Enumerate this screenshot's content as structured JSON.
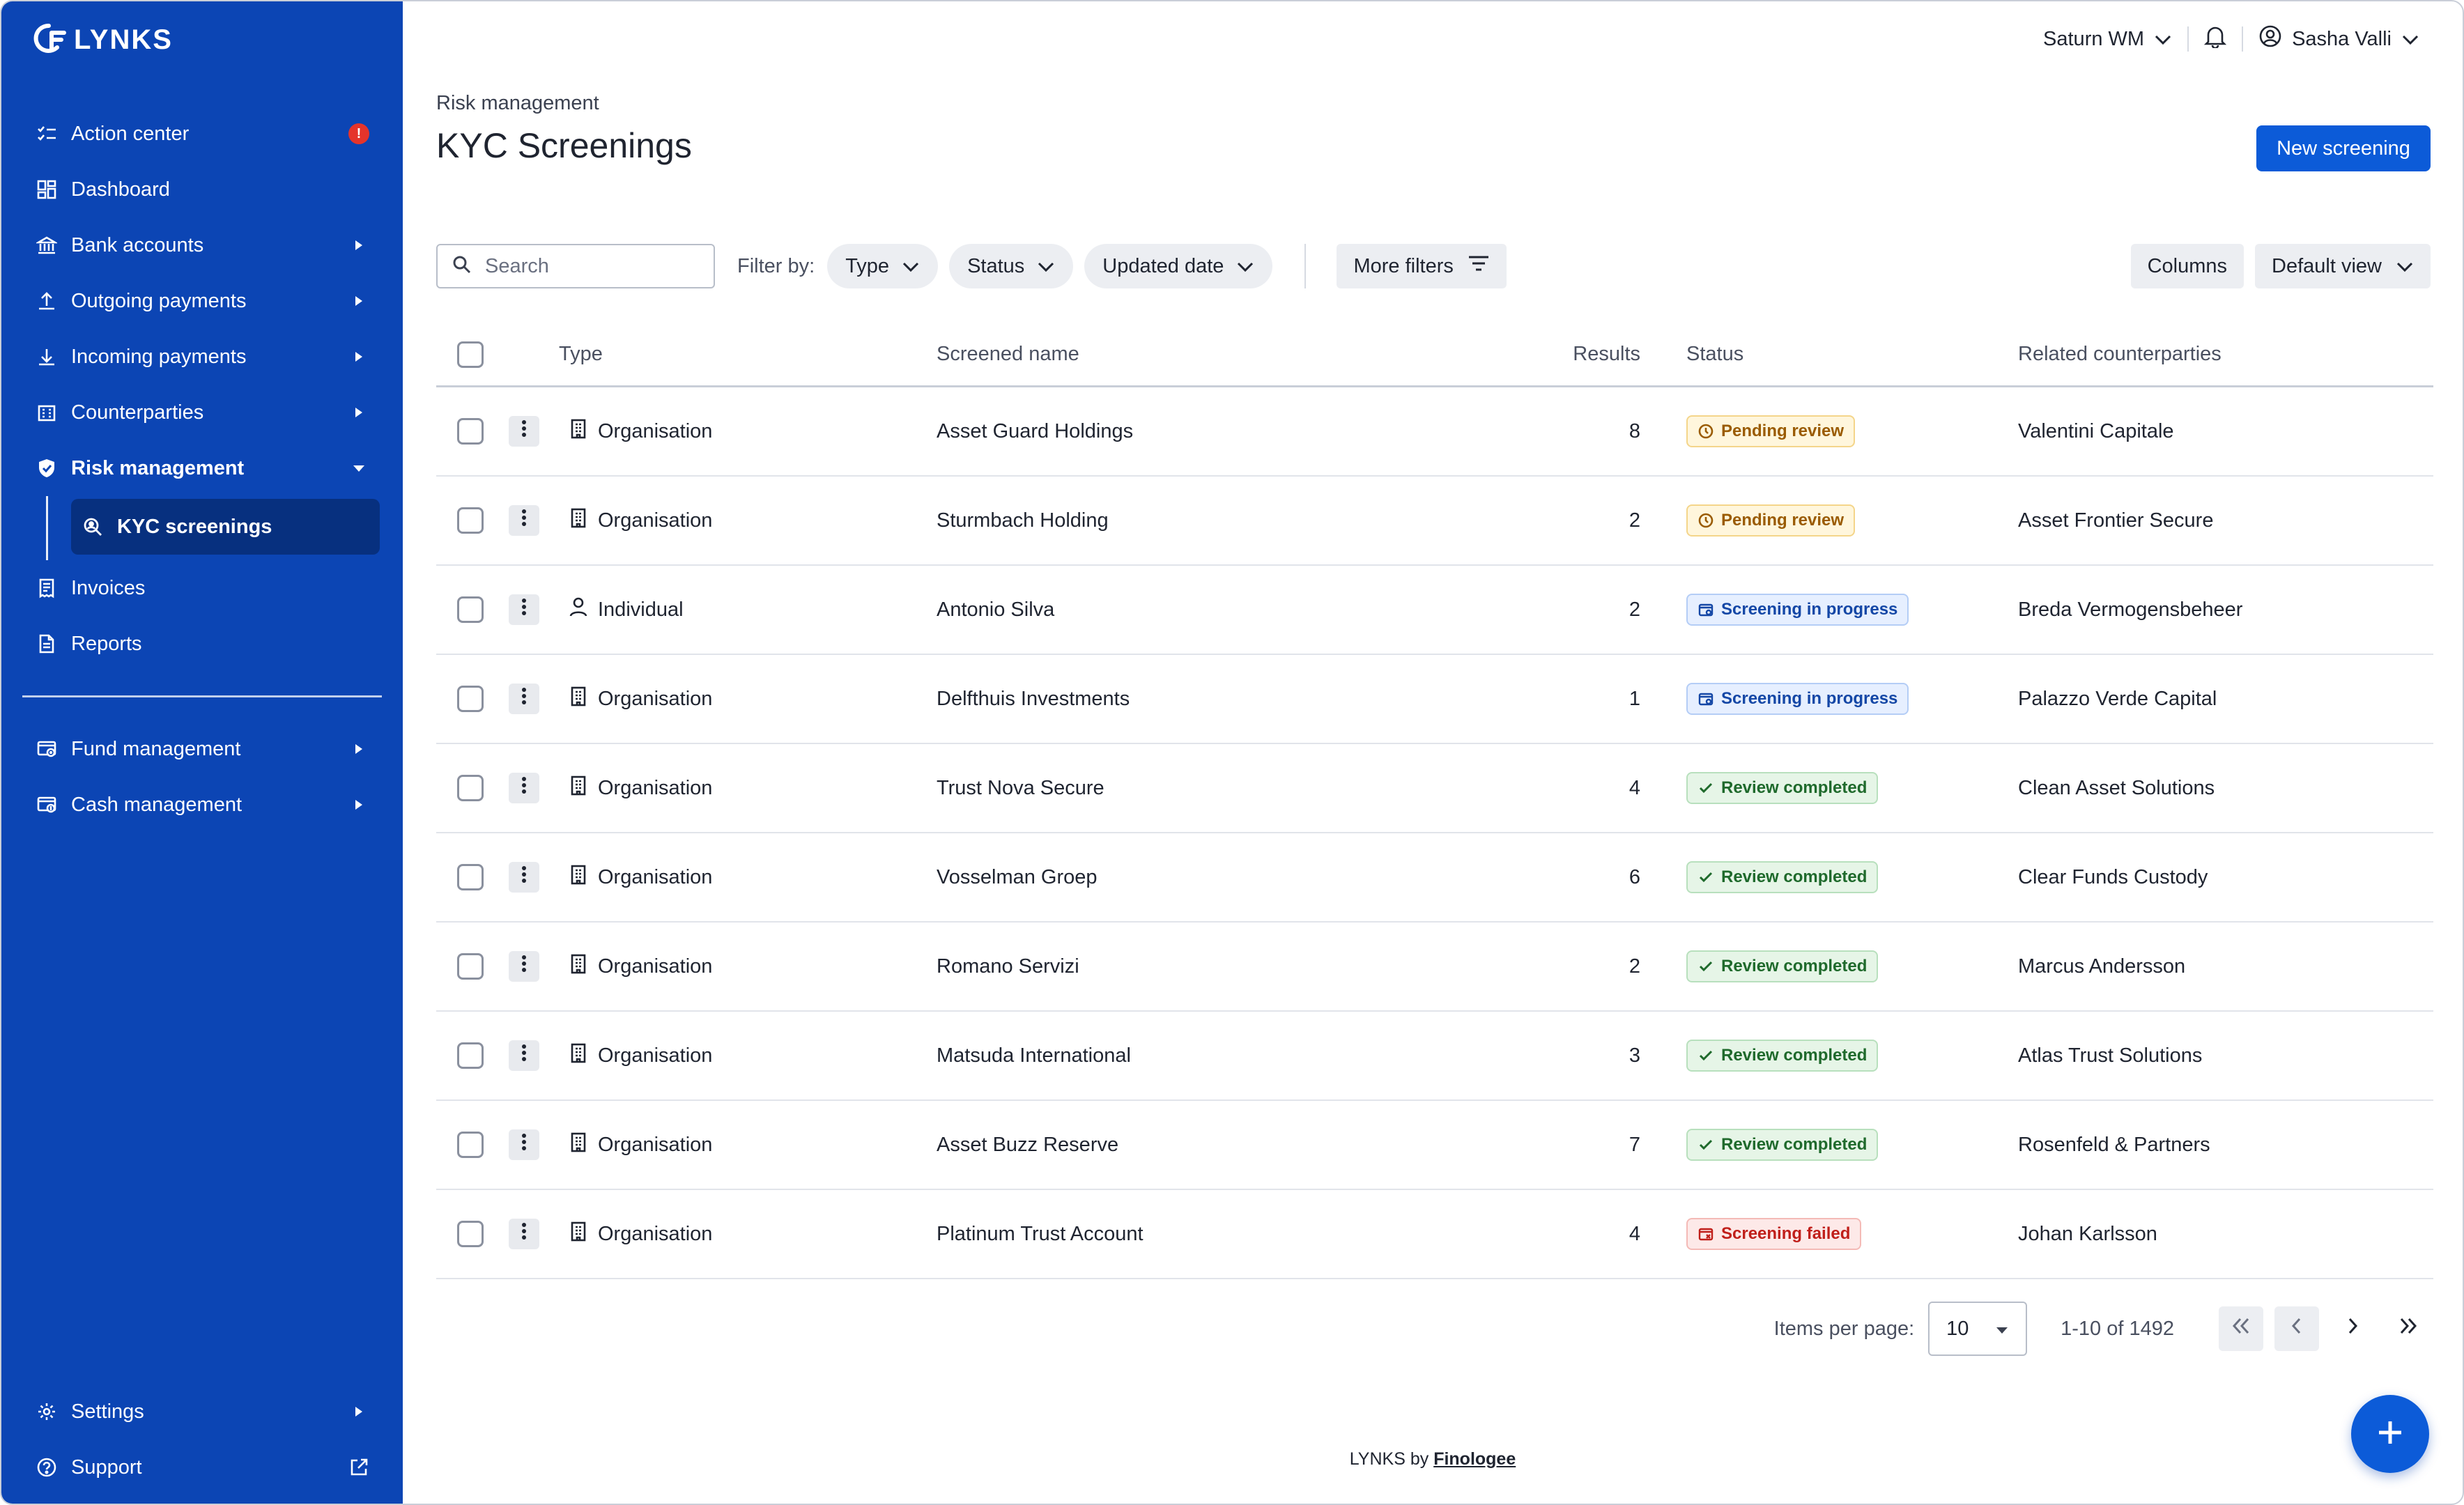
{
  "app": {
    "logo_text": "LYNKS"
  },
  "sidebar": {
    "items": [
      {
        "label": "Action center",
        "icon": "checklist-icon",
        "alert": "!"
      },
      {
        "label": "Dashboard",
        "icon": "dashboard-icon"
      },
      {
        "label": "Bank accounts",
        "icon": "bank-icon"
      },
      {
        "label": "Outgoing payments",
        "icon": "upload-icon"
      },
      {
        "label": "Incoming payments",
        "icon": "download-icon"
      },
      {
        "label": "Counterparties",
        "icon": "building-icon"
      },
      {
        "label": "Risk management",
        "icon": "shield-icon"
      }
    ],
    "sub_items": [
      {
        "label": "KYC screenings",
        "icon": "search-person-icon"
      }
    ],
    "items_after": [
      {
        "label": "Invoices",
        "icon": "invoice-icon"
      },
      {
        "label": "Reports",
        "icon": "report-icon"
      }
    ],
    "groups": [
      {
        "label": "Fund management",
        "icon": "fund-icon"
      },
      {
        "label": "Cash management",
        "icon": "cash-icon"
      }
    ],
    "bottom": [
      {
        "label": "Settings",
        "icon": "gear-icon"
      },
      {
        "label": "Support",
        "icon": "help-icon"
      }
    ]
  },
  "topbar": {
    "workspace": "Saturn WM",
    "user": "Sasha Valli"
  },
  "page": {
    "breadcrumb": "Risk management",
    "title": "KYC Screenings",
    "new_button": "New screening"
  },
  "filters": {
    "search_placeholder": "Search",
    "filter_label": "Filter by:",
    "chips": [
      "Type",
      "Status",
      "Updated date"
    ],
    "more": "More filters",
    "columns": "Columns",
    "view": "Default view"
  },
  "table": {
    "headers": {
      "type": "Type",
      "name": "Screened name",
      "results": "Results",
      "status": "Status",
      "counterparties": "Related counterparties"
    },
    "rows": [
      {
        "type": "Organisation",
        "name": "Asset Guard Holdings",
        "results": "8",
        "status": "Pending review",
        "status_kind": "pending",
        "cp": "Valentini Capitale"
      },
      {
        "type": "Organisation",
        "name": "Sturmbach Holding",
        "results": "2",
        "status": "Pending review",
        "status_kind": "pending",
        "cp": "Asset Frontier Secure"
      },
      {
        "type": "Individual",
        "name": "Antonio Silva",
        "results": "2",
        "status": "Screening in progress",
        "status_kind": "progress",
        "cp": "Breda Vermogensbeheer"
      },
      {
        "type": "Organisation",
        "name": "Delfthuis Investments",
        "results": "1",
        "status": "Screening in progress",
        "status_kind": "progress",
        "cp": "Palazzo Verde Capital"
      },
      {
        "type": "Organisation",
        "name": "Trust Nova Secure",
        "results": "4",
        "status": "Review completed",
        "status_kind": "done",
        "cp": "Clean Asset Solutions"
      },
      {
        "type": "Organisation",
        "name": "Vosselman Groep",
        "results": "6",
        "status": "Review completed",
        "status_kind": "done",
        "cp": "Clear Funds Custody"
      },
      {
        "type": "Organisation",
        "name": "Romano Servizi",
        "results": "2",
        "status": "Review completed",
        "status_kind": "done",
        "cp": "Marcus Andersson"
      },
      {
        "type": "Organisation",
        "name": "Matsuda International",
        "results": "3",
        "status": "Review completed",
        "status_kind": "done",
        "cp": "Atlas Trust Solutions"
      },
      {
        "type": "Organisation",
        "name": "Asset Buzz Reserve",
        "results": "7",
        "status": "Review completed",
        "status_kind": "done",
        "cp": "Rosenfeld & Partners"
      },
      {
        "type": "Organisation",
        "name": "Platinum Trust Account",
        "results": "4",
        "status": "Screening failed",
        "status_kind": "failed",
        "cp": "Johan Karlsson"
      }
    ]
  },
  "pagination": {
    "items_label": "Items per page:",
    "per_page": "10",
    "range": "1-10 of 1492"
  },
  "footer": {
    "prefix": "LYNKS by",
    "brand": "Finologee"
  },
  "colors": {
    "sidebar": "#0c45b4",
    "accent": "#0c5bd8",
    "active_item": "#07307f"
  }
}
